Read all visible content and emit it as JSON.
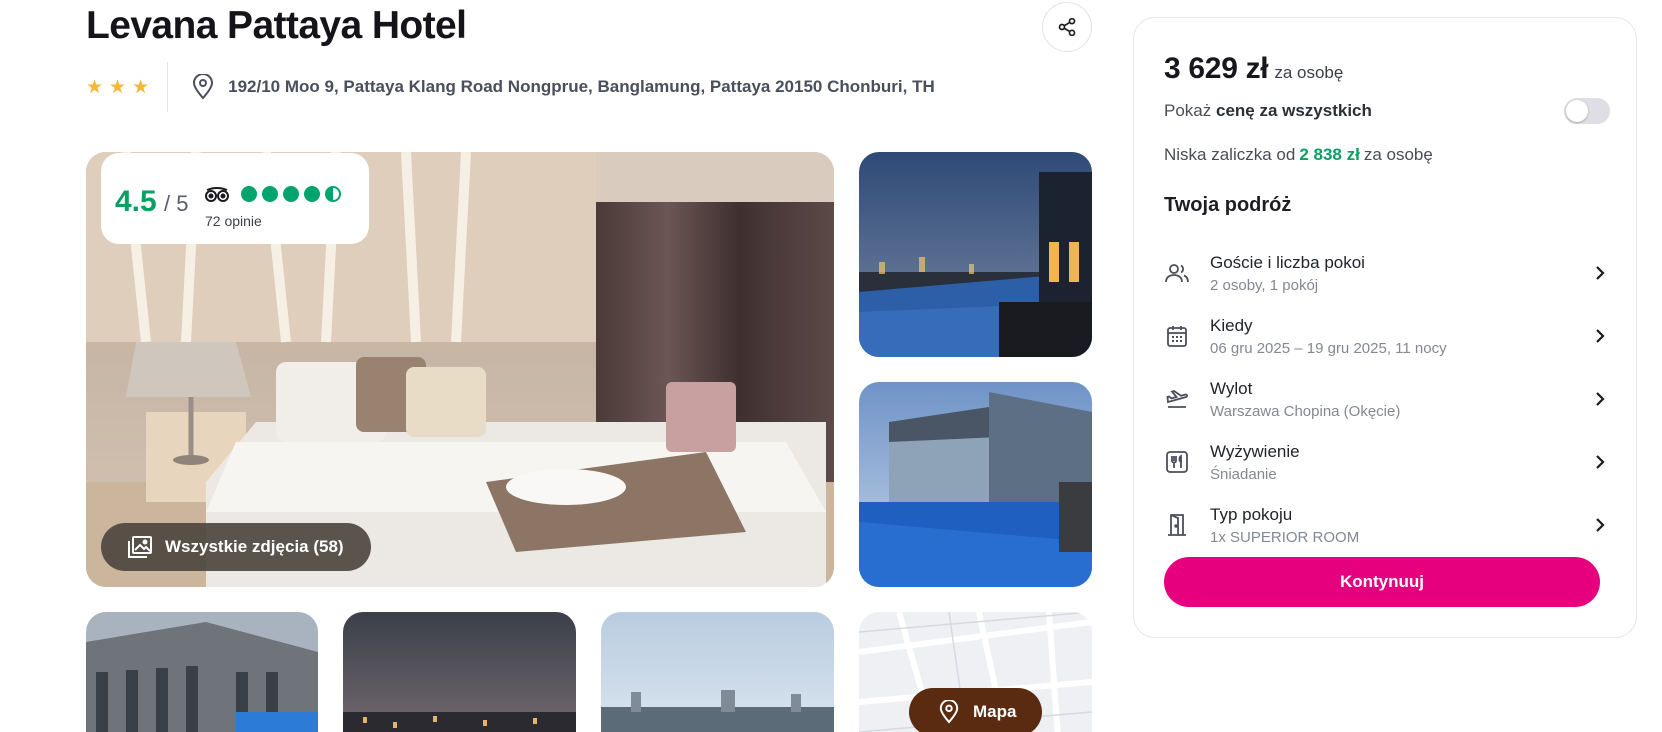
{
  "hotel": {
    "name": "Levana Pattaya Hotel",
    "stars": 3,
    "address": "192/10 Moo 9, Pattaya Klang Road Nongprue, Banglamung, Pattaya 20150 Chonburi, TH",
    "share_icon": "share-icon",
    "location_icon": "location-pin-icon"
  },
  "rating": {
    "score": "4.5",
    "max": "/ 5",
    "reviews": "72 opinie",
    "bubbles_filled": 4.5,
    "provider_icon": "tripadvisor-owl-icon",
    "color": "#0aa064"
  },
  "gallery": {
    "all_photos_label": "Wszystkie zdjęcia (58)",
    "all_photos_icon": "image-gallery-icon",
    "map_label": "Mapa",
    "map_icon": "location-pin-icon"
  },
  "booking": {
    "price": "3 629 zł",
    "price_suffix": "za osobę",
    "toggle_prefix": "Pokaż",
    "toggle_bold": "cenę za wszystkich",
    "toggle_on": false,
    "deposit_prefix": "Niska zaliczka od",
    "deposit_amount": "2 838 zł",
    "deposit_suffix": "za osobę",
    "trip_heading": "Twoja podróż",
    "trip_items": [
      {
        "label": "Goście i liczba pokoi",
        "value": "2 osoby, 1 pokój",
        "icon": "users-icon"
      },
      {
        "label": "Kiedy",
        "value": "06 gru 2025 – 19 gru 2025, 11 nocy",
        "icon": "calendar-icon"
      },
      {
        "label": "Wylot",
        "value": "Warszawa Chopina (Okęcie)",
        "icon": "plane-departure-icon"
      },
      {
        "label": "Wyżywienie",
        "value": "Śniadanie",
        "icon": "restaurant-icon"
      },
      {
        "label": "Typ pokoju",
        "value": "1x SUPERIOR ROOM",
        "icon": "door-icon"
      }
    ],
    "continue_label": "Kontynuuj",
    "accent_color": "#e6007e"
  }
}
